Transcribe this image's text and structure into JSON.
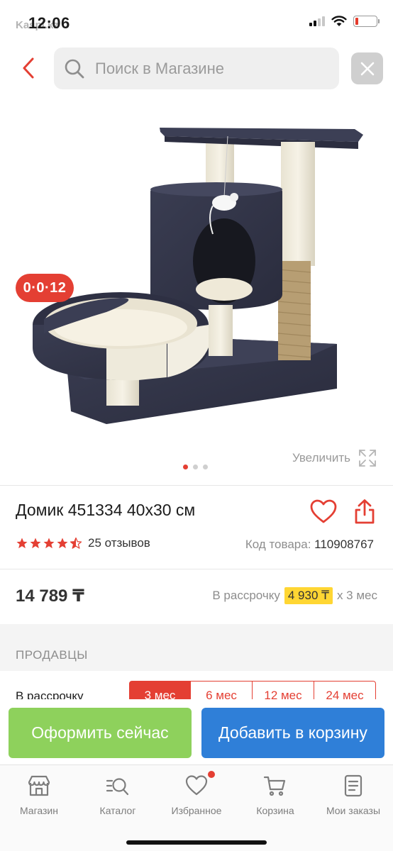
{
  "status_bar": {
    "time": "12:06",
    "carrier": "Kaspi.kz"
  },
  "search": {
    "placeholder": "Поиск в Магазине"
  },
  "product": {
    "timer": "0·0·12",
    "zoom_label": "Увеличить",
    "image_count": 3,
    "active_image": 1,
    "title": "Домик 451334 40х30 см",
    "rating": 4.5,
    "reviews": "25 отзывов",
    "code_label": "Код товара:",
    "code": "110908767",
    "price": "14 789 ₸",
    "installment_prefix": "В рассрочку",
    "installment_amount": "4 930 ₸",
    "installment_suffix": "x 3 мес"
  },
  "sellers": {
    "heading": "ПРОДАВЦЫ",
    "installment_label": "В рассрочку",
    "periods": [
      "3 мес",
      "6 мес",
      "12 мес",
      "24 мес"
    ],
    "selected_period": "3 мес"
  },
  "actions": {
    "buy_now": "Оформить сейчас",
    "add_to_cart": "Добавить в корзину"
  },
  "tab_bar": {
    "items": [
      {
        "label": "Магазин",
        "icon": "store-icon"
      },
      {
        "label": "Каталог",
        "icon": "catalog-search-icon"
      },
      {
        "label": "Избранное",
        "icon": "heart-icon",
        "has_notification": true
      },
      {
        "label": "Корзина",
        "icon": "cart-icon"
      },
      {
        "label": "Мои заказы",
        "icon": "orders-list-icon"
      }
    ]
  },
  "colors": {
    "brand_red": "#e43f33",
    "buy_green": "#8ed15c",
    "cart_blue": "#2f7fd8",
    "highlight_yellow": "#ffd633",
    "star": "#e43f33"
  }
}
